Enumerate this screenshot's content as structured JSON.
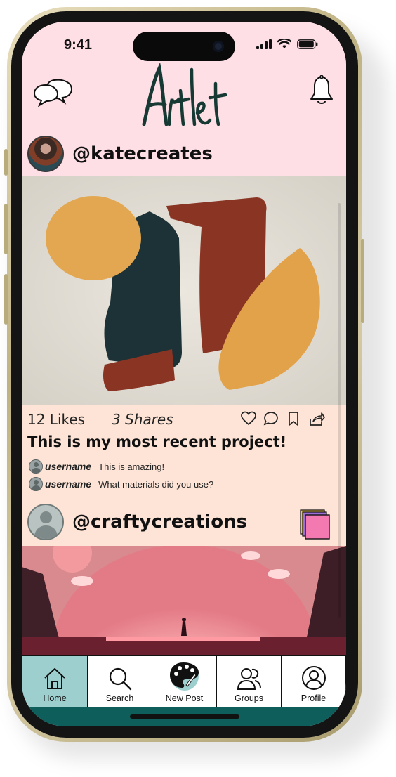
{
  "status_bar": {
    "time": "9:41"
  },
  "header": {
    "logo_text": "Artlet"
  },
  "post1": {
    "handle": "@katecreates",
    "likes": "12 Likes",
    "shares": "3 Shares",
    "caption": "This is my most recent project!",
    "comments": [
      {
        "user": "username",
        "text": "This is amazing!"
      },
      {
        "user": "username",
        "text": "What materials did you use?"
      }
    ]
  },
  "post2": {
    "handle": "@craftycreations"
  },
  "tabs": [
    {
      "label": "Home",
      "icon": "home-icon"
    },
    {
      "label": "Search",
      "icon": "search-icon"
    },
    {
      "label": "New Post",
      "icon": "palette-icon"
    },
    {
      "label": "Groups",
      "icon": "groups-icon"
    },
    {
      "label": "Profile",
      "icon": "profile-icon"
    }
  ],
  "colors": {
    "header_bg": "#ffdfe6",
    "card_bg": "#fde4d6",
    "tab_active": "#9ecfcf",
    "tab_bar": "#0e5f5b",
    "group_square": "#f27ab0"
  }
}
